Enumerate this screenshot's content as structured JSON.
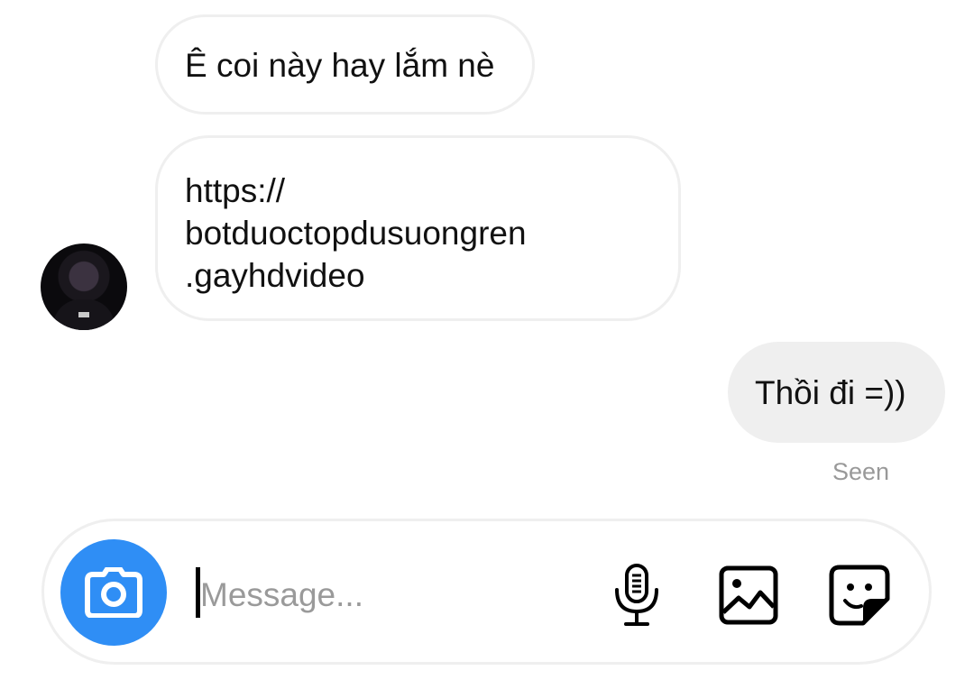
{
  "conversation": {
    "messages": [
      {
        "direction": "incoming",
        "text": "Ê coi này hay lắm nè"
      },
      {
        "direction": "incoming",
        "text": "https://\nbotduoctopdusuongren\n.gayhdvideo"
      },
      {
        "direction": "outgoing",
        "text": "Thồi đi =))"
      }
    ],
    "seen_label": "Seen"
  },
  "composer": {
    "placeholder": "Message...",
    "value": "",
    "icons": {
      "camera": "camera-icon",
      "microphone": "microphone-icon",
      "gallery": "image-icon",
      "sticker": "sticker-icon"
    }
  },
  "colors": {
    "accent": "#2f8ef5",
    "outgoing_bubble": "#efefef",
    "bubble_border": "#efefef",
    "seen_text": "#999999",
    "placeholder_text": "#9a9a9a"
  }
}
